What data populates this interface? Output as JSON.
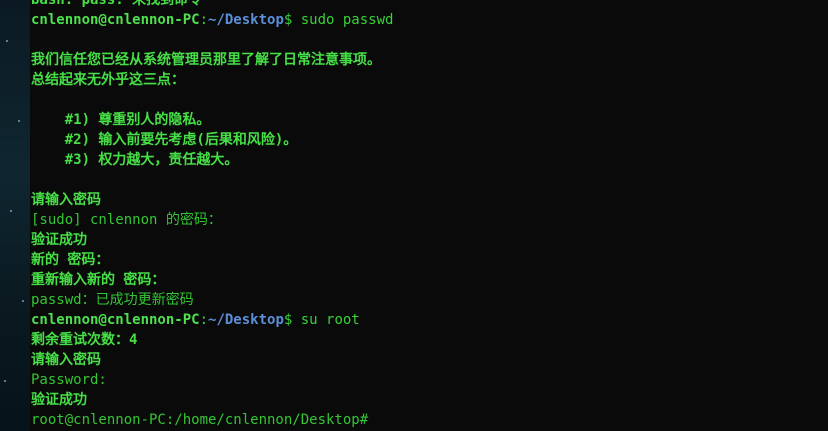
{
  "terminal": {
    "lines": {
      "l0": "bash: pass: 未找到命令",
      "l1_user": "cnlennon@cnlennon-PC",
      "l1_colon": ":",
      "l1_path": "~/Desktop",
      "l1_cmd": "$ sudo passwd",
      "l2": "",
      "l3": "我们信任您已经从系统管理员那里了解了日常注意事项。",
      "l4": "总结起来无外乎这三点：",
      "l5": "",
      "l6": "    #1) 尊重别人的隐私。",
      "l7": "    #2) 输入前要先考虑(后果和风险)。",
      "l8": "    #3) 权力越大，责任越大。",
      "l9": "",
      "l10": "请输入密码",
      "l11": "[sudo] cnlennon 的密码：",
      "l12": "验证成功",
      "l13": "新的 密码：",
      "l14": "重新输入新的 密码：",
      "l15": "passwd：已成功更新密码",
      "l16_user": "cnlennon@cnlennon-PC",
      "l16_colon": ":",
      "l16_path": "~/Desktop",
      "l16_cmd": "$ su root",
      "l17": "剩余重试次数：4",
      "l18": "请输入密码",
      "l19": "Password:",
      "l20": "验证成功",
      "l21": "root@cnlennon-PC:/home/cnlennon/Desktop#"
    }
  }
}
